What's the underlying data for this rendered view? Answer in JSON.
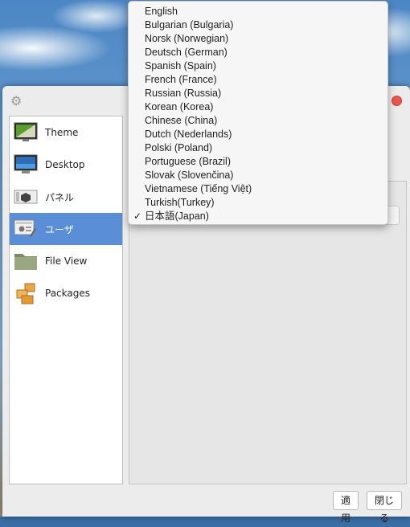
{
  "sidebar": {
    "items": [
      {
        "label": "Theme",
        "icon": "theme-icon"
      },
      {
        "label": "Desktop",
        "icon": "desktop-icon"
      },
      {
        "label": "パネル",
        "icon": "panel-icon"
      },
      {
        "label": "ユーザ",
        "icon": "user-icon",
        "selected": true
      },
      {
        "label": "File View",
        "icon": "folder-icon"
      },
      {
        "label": "Packages",
        "icon": "packages-icon"
      }
    ]
  },
  "buttons": {
    "apply": "適用",
    "close": "閉じる"
  },
  "language_menu": {
    "items": [
      "English",
      "Bulgarian (Bulgaria)",
      "Norsk (Norwegian)",
      "Deutsch (German)",
      "Spanish (Spain)",
      "French (France)",
      "Russian (Russia)",
      "Korean (Korea)",
      "Chinese (China)",
      "Dutch (Nederlands)",
      "Polski (Poland)",
      "Portuguese (Brazil)",
      "Slovak (Slovenčina)",
      "Vietnamese (Tiếng Việt)",
      "Turkish(Turkey)",
      "日本語(Japan)"
    ],
    "selected_index": 15,
    "check_mark": "✓"
  },
  "colors": {
    "accent": "#5a8fd8",
    "close": "#e9574e"
  }
}
